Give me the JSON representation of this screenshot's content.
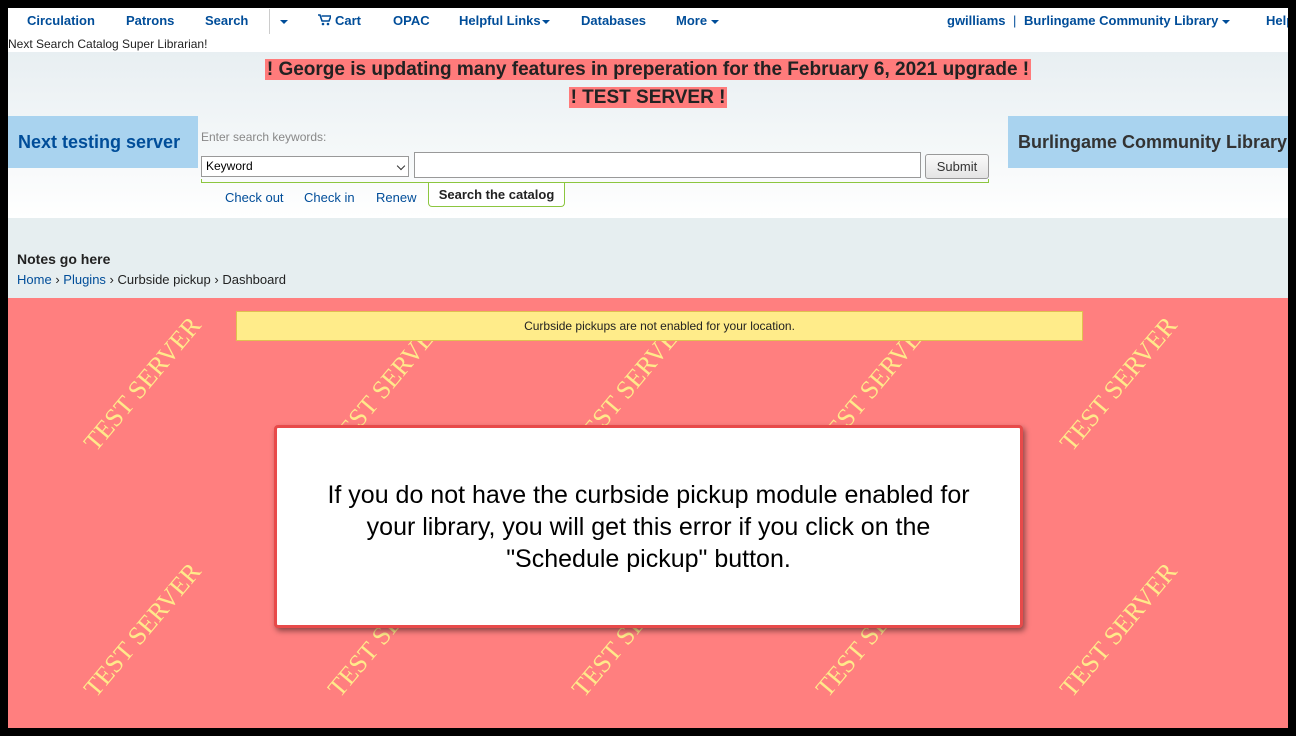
{
  "nav": {
    "circulation": "Circulation",
    "patrons": "Patrons",
    "search": "Search",
    "cart": "Cart",
    "opac": "OPAC",
    "helpful_links": "Helpful Links",
    "databases": "Databases",
    "more": "More",
    "user": "gwilliams",
    "separator": "|",
    "library": "Burlingame Community Library",
    "help": "Help"
  },
  "login_line": "Next Search Catalog Super Librarian!",
  "banners": {
    "upgrade": "! George is updating many features in preperation for the February 6, 2021 upgrade !",
    "test": "! TEST SERVER !"
  },
  "header": {
    "left_box": "Next testing server",
    "right_box": "Burlingame Community Library"
  },
  "search": {
    "label": "Enter search keywords:",
    "type_selected": "Keyword",
    "query_value": "",
    "submit_label": "Submit",
    "tabs": [
      "Check out",
      "Check in",
      "Renew",
      "Search the catalog"
    ],
    "active_tab": "Search the catalog"
  },
  "page": {
    "notes": "Notes go here",
    "breadcrumb": {
      "home": "Home",
      "plugins": "Plugins",
      "curbside": "Curbside pickup",
      "current": "Dashboard",
      "sep": "›"
    }
  },
  "main": {
    "alert": "Curbside pickups are not enabled for your location.",
    "watermark": "TEST SERVER",
    "callout": "If you do not have the curbside pickup module enabled for your library, you will get this error if you click on the \"Schedule pickup\" button."
  },
  "colors": {
    "nav_link": "#004d99",
    "banner_bg": "#ff7b7b",
    "test_area_bg": "#ff7f7f",
    "watermark": "#ffe98a",
    "alert_bg": "#ffec8a",
    "side_box_bg": "#a9d3ef",
    "accent_green": "#8cc63f"
  },
  "icons": {
    "cart": "cart-icon",
    "dropdown": "caret-down-icon"
  }
}
